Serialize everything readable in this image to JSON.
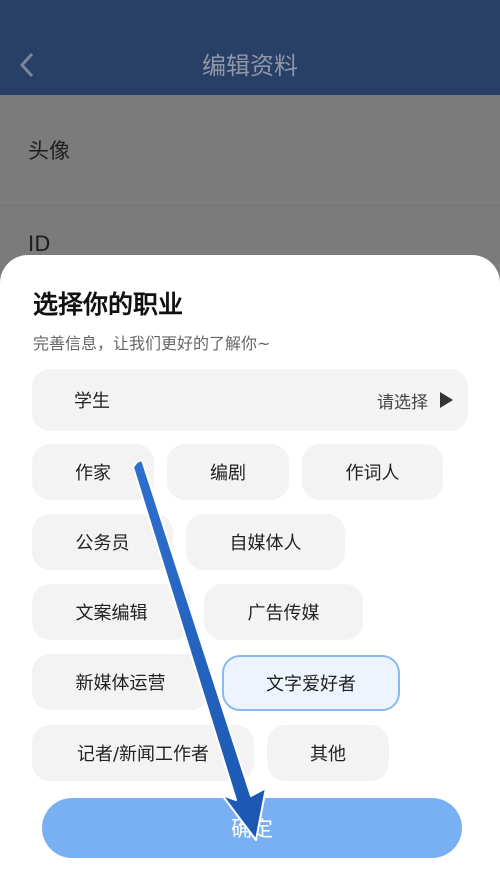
{
  "header": {
    "title": "编辑资料"
  },
  "background_rows": [
    {
      "label": "头像"
    },
    {
      "label": "ID"
    }
  ],
  "sheet": {
    "title": "选择你的职业",
    "subtitle": "完善信息，让我们更好的了解你~",
    "current": {
      "label": "学生",
      "select_label": "请选择"
    },
    "options": [
      "作家",
      "编剧",
      "作词人",
      "公务员",
      "自媒体人",
      "文案编辑",
      "广告传媒",
      "新媒体运营",
      "文字爱好者",
      "记者/新闻工作者",
      "其他"
    ],
    "selected_option": "文字爱好者",
    "confirm_label": "确定"
  },
  "colors": {
    "header_bg": "#283f66",
    "accent": "#79b0f4",
    "selected_border": "#8cb8ee",
    "annotation_arrow": "#1f5fb8"
  },
  "icons": {
    "back": "chevron-left-icon",
    "expand": "play-triangle-icon",
    "annotation": "arrow-down-icon"
  }
}
